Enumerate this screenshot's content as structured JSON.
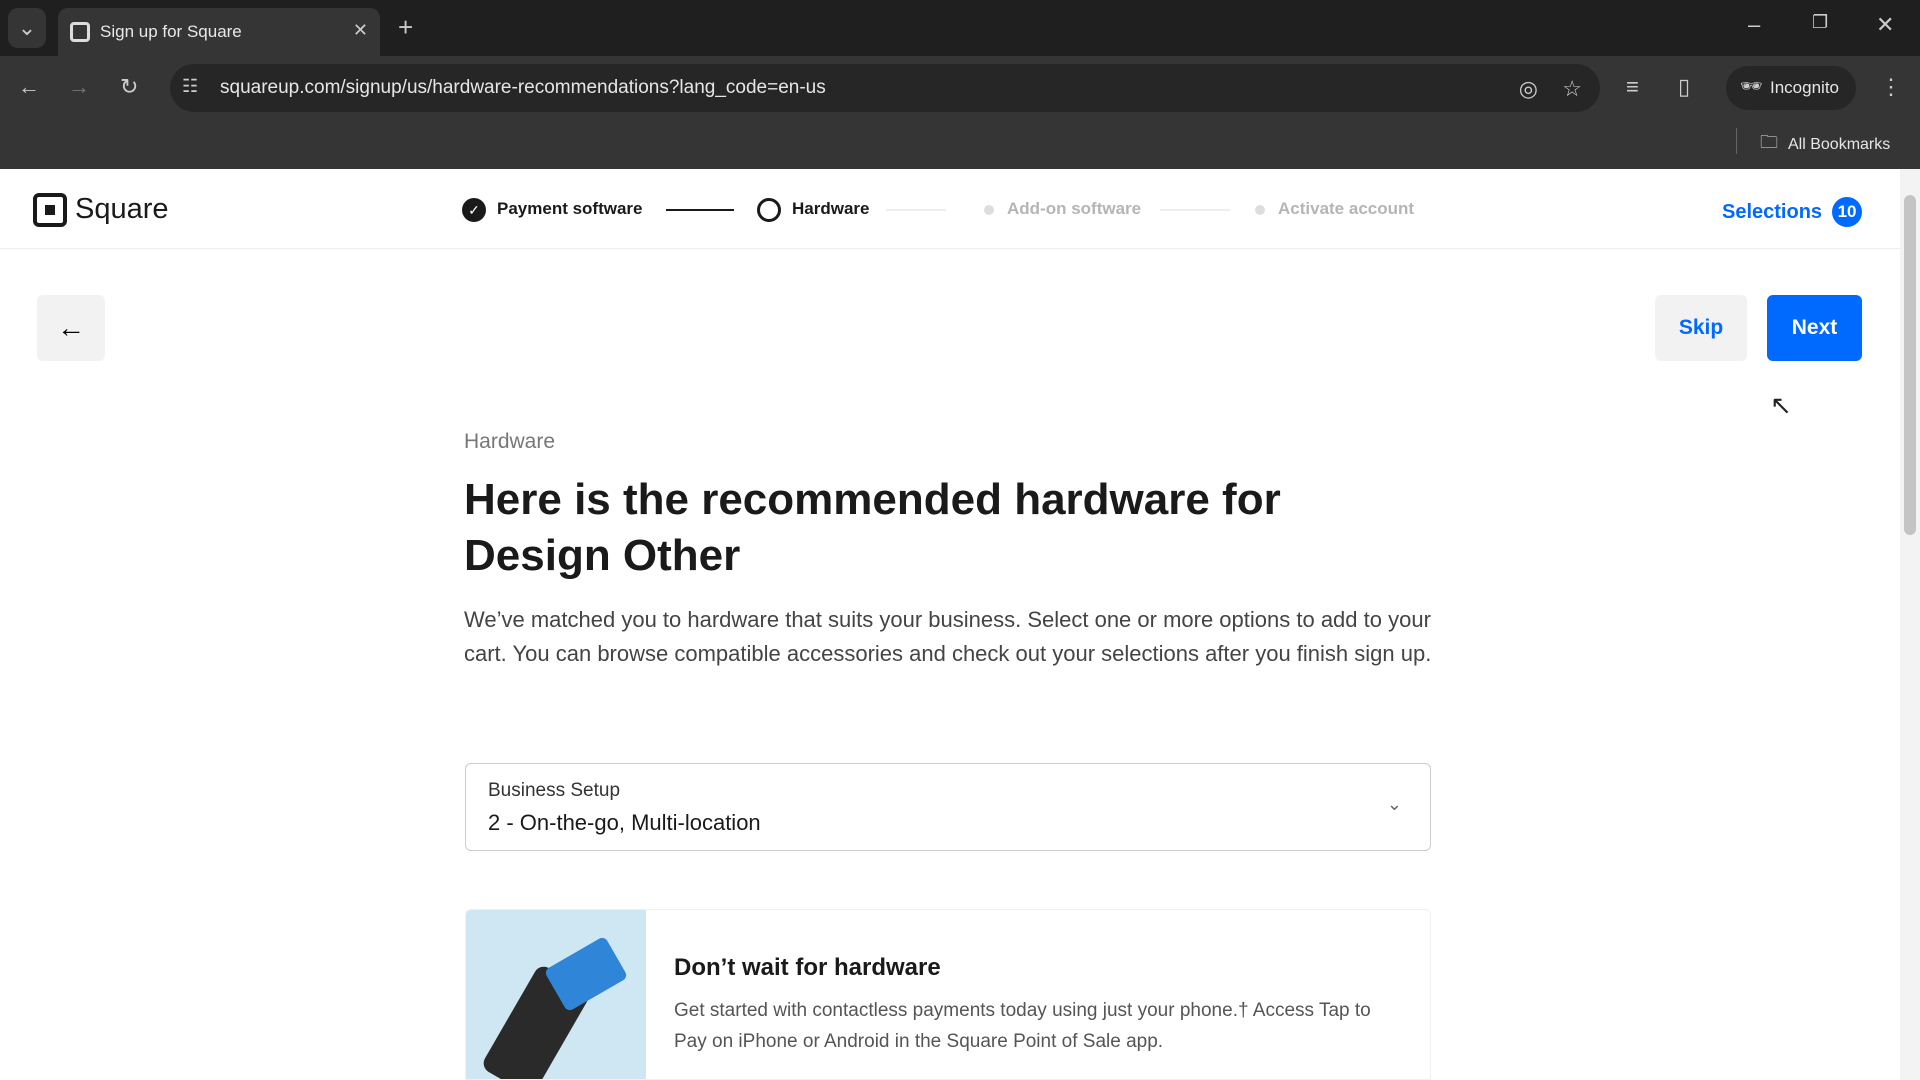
{
  "browser": {
    "tab_title": "Sign up for Square",
    "url": "squareup.com/signup/us/hardware-recommendations?lang_code=en-us",
    "profile": "Incognito",
    "bookmarks": "All Bookmarks"
  },
  "header": {
    "brand": "Square",
    "steps": [
      {
        "label": "Payment software",
        "state": "complete"
      },
      {
        "label": "Hardware",
        "state": "current"
      },
      {
        "label": "Add-on software",
        "state": "upcoming"
      },
      {
        "label": "Activate account",
        "state": "upcoming"
      }
    ],
    "selections_label": "Selections",
    "selections_count": "10"
  },
  "actions": {
    "skip": "Skip",
    "next": "Next"
  },
  "main": {
    "eyebrow": "Hardware",
    "title": "Here is the recommended hardware for Design Other",
    "description": "We’ve matched you to hardware that suits your business. Select one or more options to add to your cart. You can browse compatible accessories and check out your selections after you finish sign up.",
    "select": {
      "label": "Business Setup",
      "value": "2 - On-the-go, Multi-location"
    },
    "card": {
      "title": "Don’t wait for hardware",
      "text": "Get started with contactless payments today using just your phone.† Access Tap to Pay on iPhone or Android in the Square Point of Sale app."
    }
  },
  "colors": {
    "accent": "#006aff",
    "text": "#1a1a1a"
  }
}
